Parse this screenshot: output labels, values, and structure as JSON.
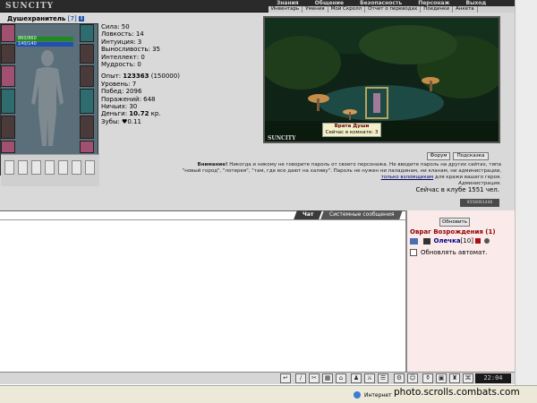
{
  "header": {
    "logo": "SUNCITY",
    "menu_top": [
      "Знания",
      "Общение",
      "Безопасность",
      "Персонаж",
      "Выход"
    ],
    "menu_sub": [
      "Инвентарь",
      "Умения",
      "Мой Скролл",
      "Отчет о переводах",
      "Поединки",
      "Анкета"
    ]
  },
  "character": {
    "name": "Душехранитель",
    "level": "[7]",
    "hp": "860/860",
    "mp": "140/140",
    "stats": {
      "strength": "Сила: 50",
      "agility": "Ловкость: 14",
      "intuition": "Интуиция: 3",
      "endurance": "Выносливость: 35",
      "intellect": "Интеллект: 0",
      "wisdom": "Мудрость: 0",
      "exp_label": "Опыт: ",
      "exp_value": "123363",
      "exp_next": " (150000)",
      "level": "Уровень: 7",
      "wins": "Побед: 2096",
      "losses": "Поражений: 648",
      "draws": "Ничьих: 30",
      "money_label": "Деньги: ",
      "money_value": "10.72",
      "money_unit": " кр.",
      "teeth": "Зубы: ♥0.11"
    }
  },
  "scene": {
    "location": "Врата Души",
    "in_room": "Сейчас в комнате: 3",
    "logo": "SUNCITY"
  },
  "buttons": {
    "forum": "Форум",
    "hint": "Подсказка",
    "refresh": "Обновить"
  },
  "warning": {
    "bold": "Внимание!",
    "text": " Никогда и никому не говорите пароль от своего персонажа. Не вводите пароль на других сайтах, типа \"новый город\", \"лотерея\", \"там, где все дают на халяву\". Пароль не нужен ни паладинам, ни кланам, ни администрации,",
    "link": "только взломщикам",
    "tail": " для кражи вашего героя.",
    "sign": "Администрация."
  },
  "online": "Сейчас в клубе 1551 чел.",
  "counter": "9556061446",
  "tabs": [
    "Чат",
    "Системные сообщения"
  ],
  "room_panel": {
    "room_name": "Овраг Возрождения (1)",
    "user_name": "Олечка",
    "user_level": "[10]",
    "auto_refresh": "Обновлять автомат."
  },
  "clock": "22:04",
  "statusbar": {
    "zone": "Интернет"
  },
  "watermark": "photo.scrolls.combats.com"
}
